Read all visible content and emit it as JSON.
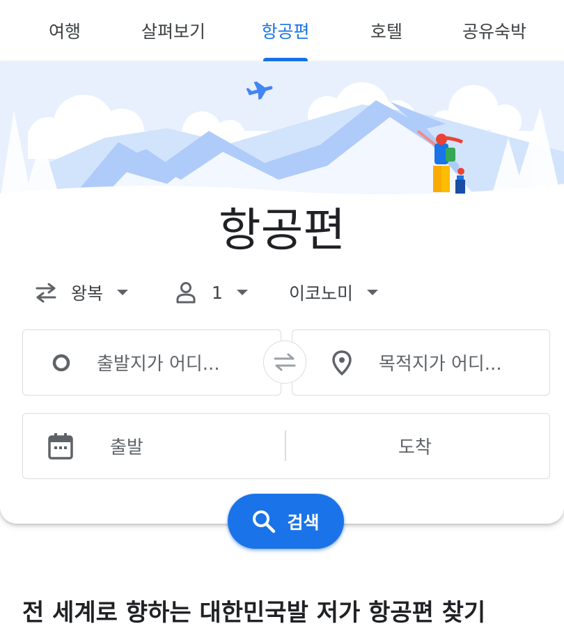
{
  "tabs": [
    {
      "label": "여행",
      "active": false
    },
    {
      "label": "살펴보기",
      "active": false
    },
    {
      "label": "항공편",
      "active": true
    },
    {
      "label": "호텔",
      "active": false
    },
    {
      "label": "공유숙박",
      "active": false
    }
  ],
  "hero": {
    "title": "항공편"
  },
  "options": {
    "trip_type": "왕복",
    "passengers": "1",
    "cabin_class": "이코노미"
  },
  "fields": {
    "origin_placeholder": "출발지가 어디...",
    "destination_placeholder": "목적지가 어디...",
    "departure_placeholder": "출발",
    "return_placeholder": "도착"
  },
  "search_button": {
    "label": "검색"
  },
  "section": {
    "title": "전 세계로 향하는 대한민국발 저가 항공편 찾기"
  },
  "colors": {
    "accent": "#1a73e8",
    "text": "#3c4043",
    "border": "#dadce0"
  }
}
